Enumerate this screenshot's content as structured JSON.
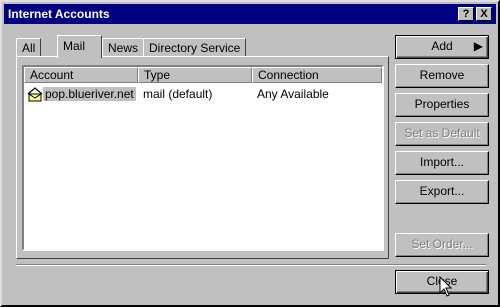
{
  "window": {
    "title": "Internet Accounts",
    "help_glyph": "?",
    "close_glyph": "X"
  },
  "tabs": [
    {
      "label": "All"
    },
    {
      "label": "Mail"
    },
    {
      "label": "News"
    },
    {
      "label": "Directory Service"
    }
  ],
  "list": {
    "columns": [
      "Account",
      "Type",
      "Connection"
    ],
    "rows": [
      {
        "account": "pop.blueriver.net",
        "type": "mail (default)",
        "connection": "Any Available",
        "icon": "mail-account-icon"
      }
    ]
  },
  "buttons": {
    "add": "Add",
    "remove": "Remove",
    "properties": "Properties",
    "set_default": "Set as Default",
    "import": "Import...",
    "export": "Export...",
    "set_order": "Set Order...",
    "close": "Close"
  },
  "colors": {
    "titlebar": "#000080",
    "face": "#c0c0c0"
  }
}
